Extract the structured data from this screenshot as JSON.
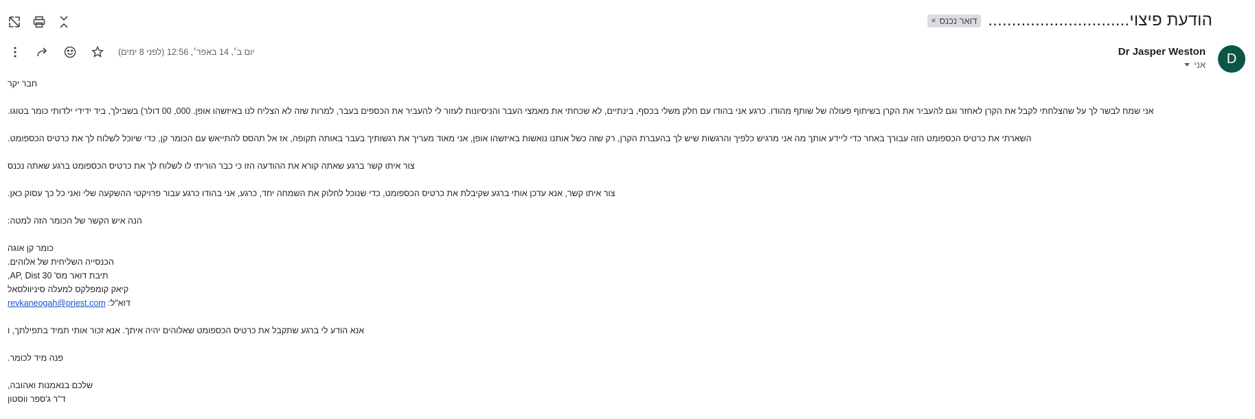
{
  "toolbar": {
    "icons": [
      "expand-icon",
      "print-icon",
      "collapse-icon"
    ]
  },
  "subject": "הודעת פיצוי..............................",
  "label_chip": {
    "text": "דואר נכנס",
    "close": "×"
  },
  "sender": {
    "avatar_initial": "D",
    "avatar_color": "#0b5647",
    "name": "Dr Jasper Weston",
    "recipient": "אני"
  },
  "date_text": "יום ב׳, 14 באפר׳, 12:56 (לפני 8 ימים)",
  "actions": [
    "more-icon",
    "forward-icon",
    "emoji-icon",
    "star-icon"
  ],
  "body": {
    "greeting": "חבר יקר",
    "p1": "אני שמח לבשר לך על שהצלחתי לקבל את הקרן לאחזר וגם להעביר את הקרן בשיתוף פעולה של שותף מהודו. כרגע אני בהודו עם חלק משלי בכסף, בינתיים, לא שכחתי את מאמצי העבר והניסיונות לעזור לי להעביר את הכספים בעבר, למרות שזה לא הצליח לנו באיזשהו אופן. 000, 00 דולר) בשבילך, ביד ידידי ילדותי כומר בטוגו.",
    "p2": "השארתי את כרטיס הכספומט הזה עבורך באחר כדי ליידע אותך מה אני מרגיש כלפיך והרגשות שיש לך בהעברת הקרן, רק שזה כשל אותנו נואשות באיזשהו אופן, אני מאוד מעריך את רגשותיך בעבר באותה תקופה, אז אל תהסס להתייאש עם הכומר קן, כדי שיוכל לשלוח לך את כרטיס הכספומט.",
    "p3": "צור איתו קשר ברגע שאתה קורא את ההודעה הזו כי כבר הוריתי לו לשלוח לך את כרטיס הכספומט ברגע שאתה נכנס",
    "p4": "צור איתו קשר, אנא עדכן אותי ברגע שקיבלת את כרטיס הכספומט, כדי שנוכל לחלוק את השמחה יחד, כרגע, אני בהודו כרגע עבור פרויקטי ההשקעה שלי ואני כל כך עסוק כאן.",
    "p5": "הנה איש הקשר של הכומר הזה למטה:",
    "contact_name": "כומר קן אוגה",
    "contact_org": "הכנסייה השליחית של אלוהים.",
    "contact_po": "תיבת דואר מס' 30 AP, Dist,",
    "contact_addr": "קיאק קומפלקס למעלה סיניוולסאל",
    "email_label": "דוא\"ל:",
    "email": "revkaneogah@priest.com",
    "p6": "אנא הודע לי ברגע שתקבל את כרטיס הכספומט שאלוהים יהיה איתך. אנא זכור אותי תמיד בתפילתך, ו",
    "p7": "פנה מיד לכומר.",
    "closing": "שלכם בנאמנות ואהובה,",
    "signature": "ד\"ר ג'ספר ווסטון"
  }
}
